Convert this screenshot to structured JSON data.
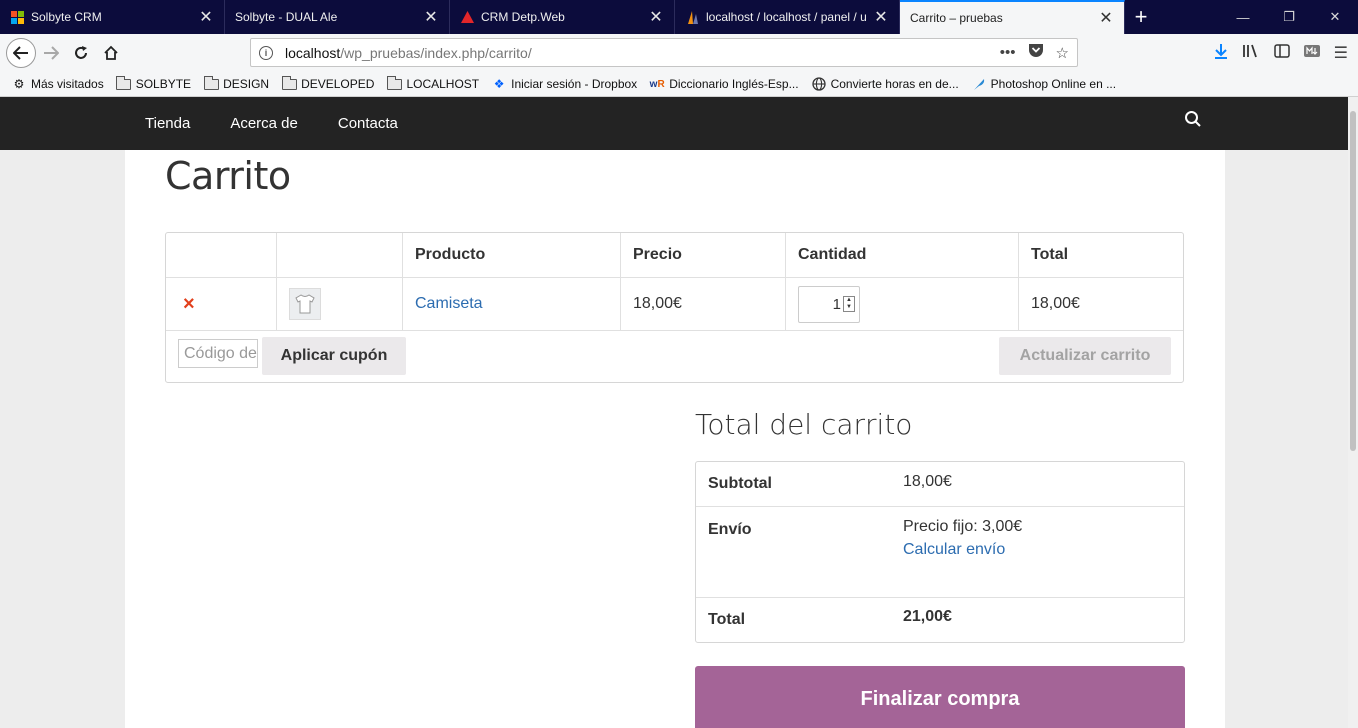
{
  "tabs": [
    {
      "title": "Solbyte CRM",
      "icon": "windows-logo-icon"
    },
    {
      "title": "Solbyte - DUAL Ale",
      "icon": "none"
    },
    {
      "title": "CRM Detp.Web",
      "icon": "red-triangle-icon"
    },
    {
      "title": "localhost / localhost / panel / u",
      "icon": "phpmyadmin-icon"
    },
    {
      "title": "Carrito – pruebas",
      "icon": "none",
      "active": true
    }
  ],
  "url": {
    "host": "localhost",
    "path": "/wp_pruebas/index.php/carrito/"
  },
  "bookmarks": [
    {
      "label": "Más visitados",
      "icon": "gear-icon"
    },
    {
      "label": "SOLBYTE",
      "icon": "folder-icon"
    },
    {
      "label": "DESIGN",
      "icon": "folder-icon"
    },
    {
      "label": "DEVELOPED",
      "icon": "folder-icon"
    },
    {
      "label": "LOCALHOST",
      "icon": "folder-icon"
    },
    {
      "label": "Iniciar sesión - Dropbox",
      "icon": "dropbox-icon"
    },
    {
      "label": "Diccionario Inglés-Esp...",
      "icon": "wordreference-icon"
    },
    {
      "label": "Convierte horas en de...",
      "icon": "globe-icon"
    },
    {
      "label": "Photoshop Online en ...",
      "icon": "feather-icon"
    }
  ],
  "site": {
    "menu": [
      "Tienda",
      "Acerca de",
      "Contacta"
    ],
    "page_title": "Carrito"
  },
  "cart": {
    "headers": {
      "product": "Producto",
      "price": "Precio",
      "quantity": "Cantidad",
      "total": "Total"
    },
    "items": [
      {
        "remove": "×",
        "product": "Camiseta",
        "price": "18,00€",
        "quantity": "1",
        "total": "18,00€"
      }
    ],
    "coupon_placeholder": "Código de cupón",
    "apply_coupon": "Aplicar cupón",
    "update_cart": "Actualizar carrito"
  },
  "totals": {
    "title": "Total del carrito",
    "subtotal_label": "Subtotal",
    "subtotal_value": "18,00€",
    "shipping_label": "Envío",
    "shipping_value": "Precio fijo: 3,00€",
    "calc_shipping": "Calcular envío",
    "total_label": "Total",
    "total_value": "21,00€",
    "checkout": "Finalizar compra"
  },
  "colors": {
    "accent": "#a46497",
    "link": "#2c6cb0",
    "remove": "#e2401c",
    "header": "#232323"
  }
}
